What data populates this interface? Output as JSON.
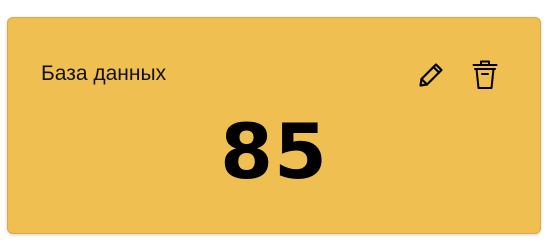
{
  "card": {
    "title": "База данных",
    "value": "85",
    "background_color": "#f0bf51",
    "actions": [
      {
        "name": "edit",
        "icon": "pencil-icon"
      },
      {
        "name": "delete",
        "icon": "trash-icon"
      }
    ]
  }
}
